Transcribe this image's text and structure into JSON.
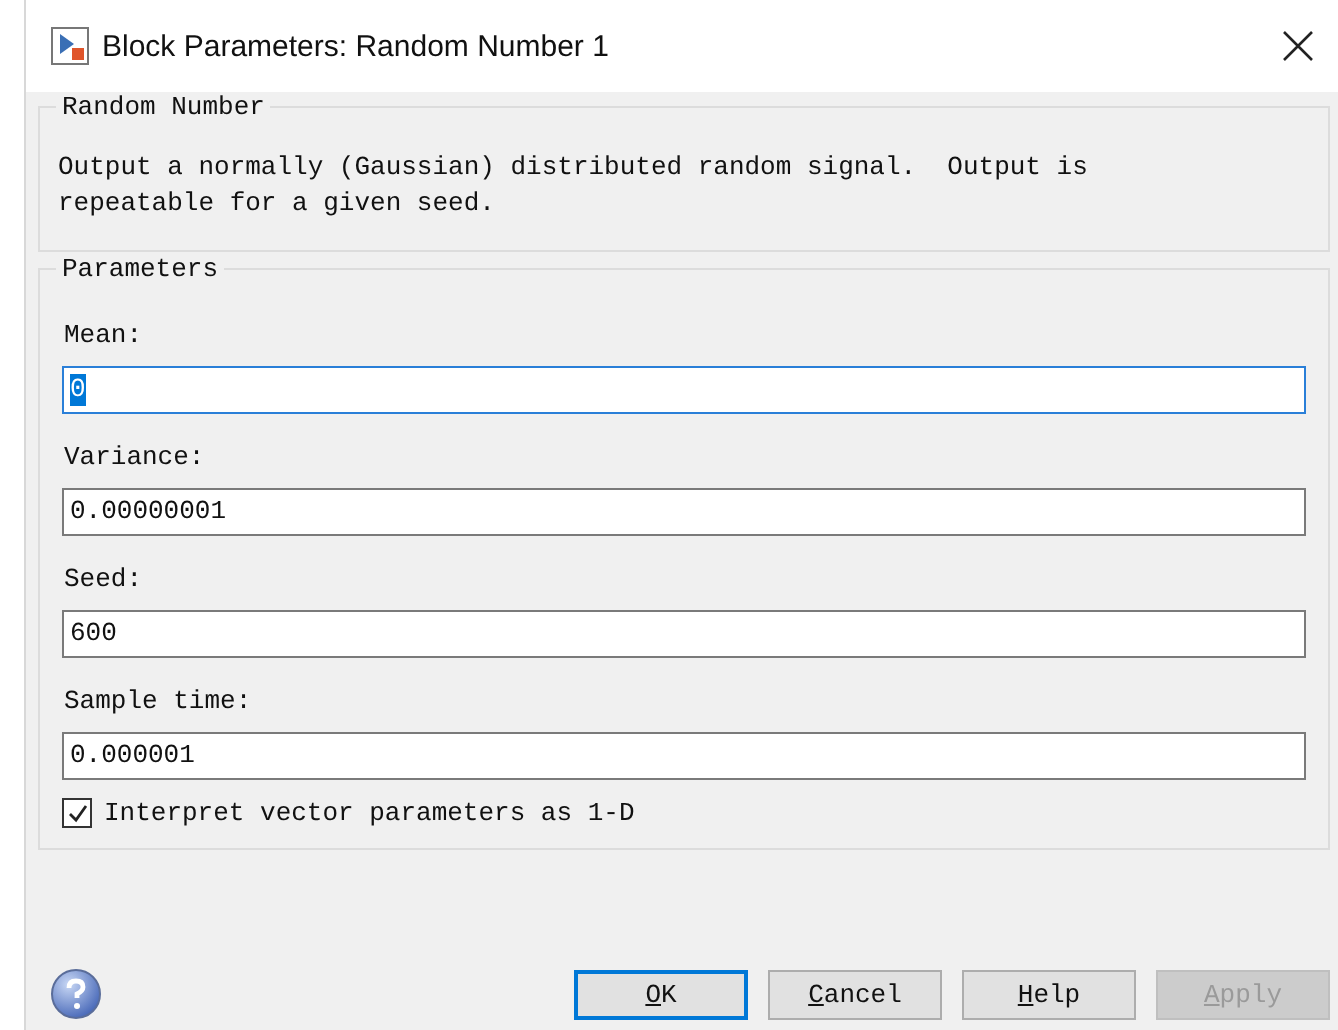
{
  "window": {
    "title": "Block Parameters: Random Number 1"
  },
  "description": {
    "title": "Random Number",
    "text": "Output a normally (Gaussian) distributed random signal.  Output is\nrepeatable for a given seed."
  },
  "parameters": {
    "title": "Parameters",
    "fields": [
      {
        "label": "Mean:",
        "value": "0",
        "focused": true,
        "selected": true
      },
      {
        "label": "Variance:",
        "value": "0.00000001",
        "focused": false,
        "selected": false
      },
      {
        "label": "Seed:",
        "value": "600",
        "focused": false,
        "selected": false
      },
      {
        "label": "Sample time:",
        "value": "0.000001",
        "focused": false,
        "selected": false
      }
    ],
    "checkbox": {
      "label": "Interpret vector parameters as 1-D",
      "checked": true
    }
  },
  "buttons": [
    {
      "label": "OK",
      "mnemonic": true,
      "default": true,
      "disabled": false
    },
    {
      "label": "Cancel",
      "mnemonic": true,
      "default": false,
      "disabled": false
    },
    {
      "label": "Help",
      "mnemonic": true,
      "default": false,
      "disabled": false
    },
    {
      "label": "Apply",
      "mnemonic": true,
      "default": false,
      "disabled": true
    }
  ]
}
